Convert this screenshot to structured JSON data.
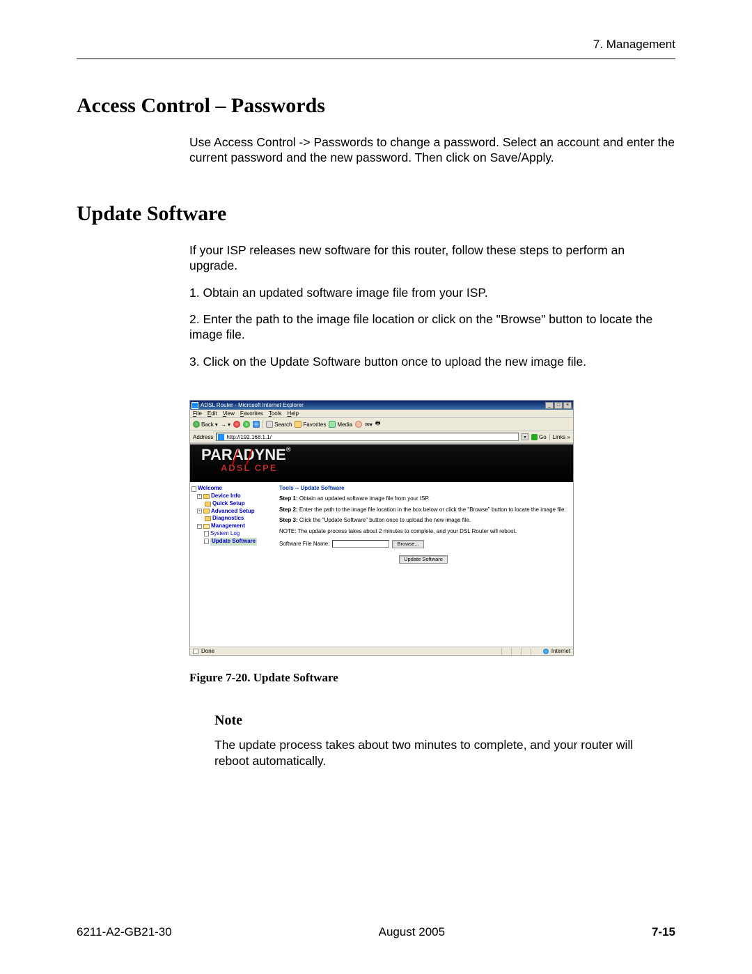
{
  "header": {
    "right": "7. Management"
  },
  "section1": {
    "title": "Access Control – Passwords",
    "para": "Use Access Control -> Passwords to change a password. Select an account and enter the current password and the new password. Then click on Save/Apply."
  },
  "section2": {
    "title": "Update Software",
    "intro": "If your ISP releases new software for this router, follow these steps to perform an upgrade.",
    "step1": "1.   Obtain an updated software image file from your ISP.",
    "step2": "2.   Enter the path to the image file location or click on the \"Browse\" button to locate the image file.",
    "step3": "3.   Click on the Update Software button once to upload the new image file."
  },
  "figure": {
    "caption": "Figure 7-20.   Update Software"
  },
  "note": {
    "head": "Note",
    "body": "The update process takes about two minutes to complete, and your router will reboot automatically."
  },
  "footer": {
    "doc": "6211-A2-GB21-30",
    "date": "August 2005",
    "page": "7-15"
  },
  "ie": {
    "title": "ADSL Router - Microsoft Internet Explorer",
    "menu": {
      "file": "File",
      "edit": "Edit",
      "view": "View",
      "favorites": "Favorites",
      "tools": "Tools",
      "help": "Help"
    },
    "toolbar": {
      "back": "Back",
      "search": "Search",
      "favorites": "Favorites",
      "media": "Media"
    },
    "addr": {
      "label": "Address",
      "url": "http://192.168.1.1/",
      "go": "Go",
      "links": "Links"
    },
    "brand": "PARADYNE",
    "subbrand": "ADSL CPE",
    "tree": {
      "welcome": "Welcome",
      "device": "Device Info",
      "quick": "Quick Setup",
      "adv": "Advanced Setup",
      "diag": "Diagnostics",
      "mgmt": "Management",
      "syslog": "System Log",
      "update": "Update Software"
    },
    "main": {
      "title": "Tools -- Update Software",
      "s1": "Step 1: Obtain an updated software image file from your ISP.",
      "s2": "Step 2: Enter the path to the image file location in the box below or click the \"Browse\" button to locate the image file.",
      "s3": "Step 3: Click the \"Update Software\" button once to upload the new image file.",
      "note": "NOTE: The update process takes about 2 minutes to complete, and your DSL Router will reboot.",
      "label": "Software File Name:",
      "browse": "Browse...",
      "update": "Update Software"
    },
    "status": {
      "done": "Done",
      "zone": "Internet"
    }
  }
}
